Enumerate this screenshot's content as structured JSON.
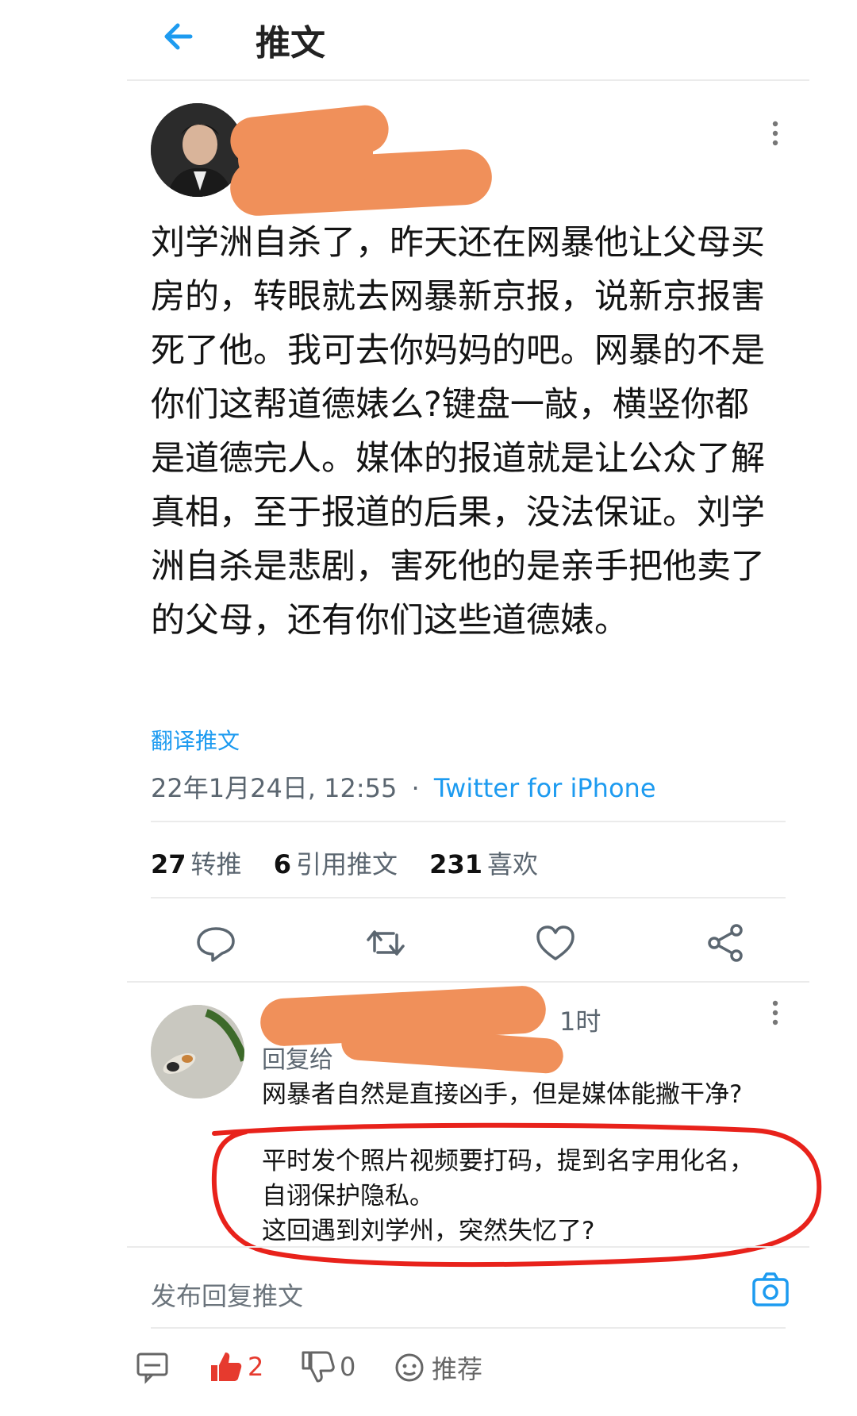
{
  "header": {
    "title": "推文"
  },
  "tweet": {
    "text": "刘学洲自杀了，昨天还在网暴他让父母买房的，转眼就去网暴新京报，说新京报害死了他。我可去你妈妈的吧。网暴的不是你们这帮道德婊么?键盘一敲，横竖你都是道德完人。媒体的报道就是让公众了解真相，至于报道的后果，没法保证。刘学洲自杀是悲剧，害死他的是亲手把他卖了的父母，还有你们这些道德婊。",
    "translate": "翻译推文",
    "datetime": "22年1月24日, 12:55",
    "separator": "·",
    "source": "Twitter for iPhone"
  },
  "stats": {
    "retweets_count": "27",
    "retweets_label": "转推",
    "quotes_count": "6",
    "quotes_label": "引用推文",
    "likes_count": "231",
    "likes_label": "喜欢"
  },
  "reply": {
    "time": "1时",
    "reply_to_label": "回复给",
    "line1": "网暴者自然是直接凶手，但是媒体能撇干净?",
    "line2": "平时发个照片视频要打码，提到名字用化名，",
    "line3": "自诩保护隐私。",
    "line4": "这回遇到刘学州，突然失忆了?"
  },
  "compose": {
    "placeholder": "发布回复推文"
  },
  "bottom_bar": {
    "like_count": "2",
    "dislike_count": "0",
    "recommend_label": "推荐"
  },
  "colors": {
    "accent": "#1d9bf0",
    "annotation": "#e8221b",
    "redaction": "#f0905a",
    "like_red": "#e63a2e"
  }
}
